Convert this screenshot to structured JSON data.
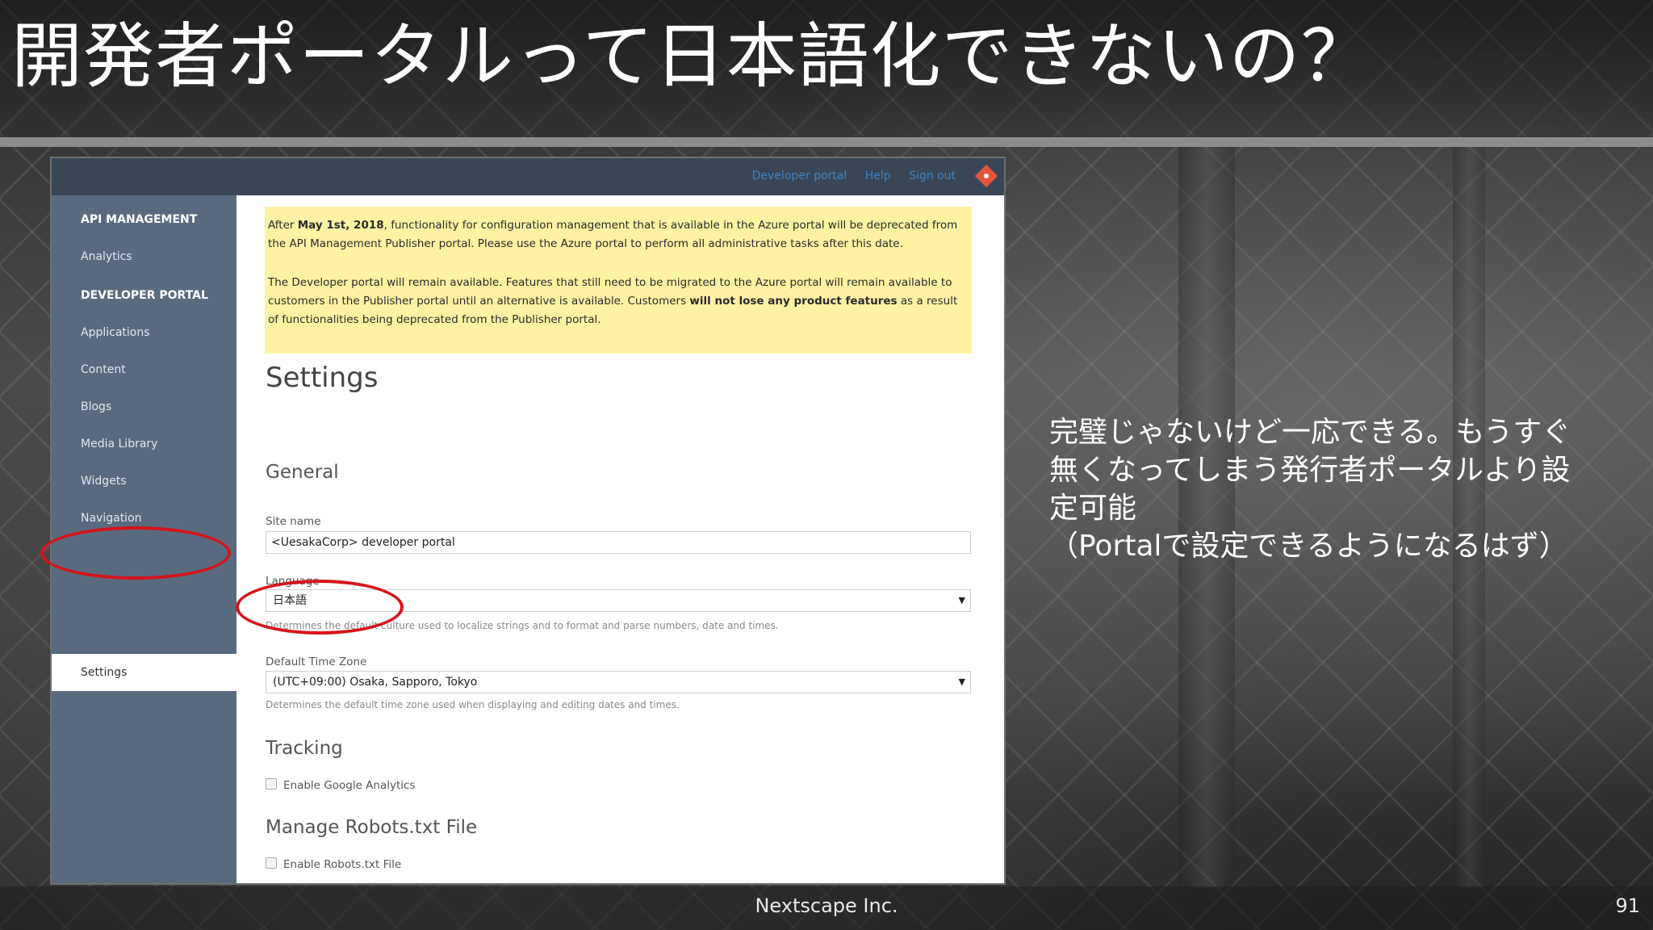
{
  "slide": {
    "title": "開発者ポータルって日本語化できないの？",
    "note_lines": [
      "完璧じゃないけど一応できる。もうすぐ",
      "無くなってしまう発行者ポータルより設",
      "定可能",
      "（Portalで設定できるようになるはず）"
    ],
    "footer_company": "Nextscape Inc.",
    "page_number": "91"
  },
  "portal": {
    "top_links": [
      "Developer portal",
      "Help",
      "Sign out"
    ],
    "sidebar": {
      "section_api": "API MANAGEMENT",
      "analytics": "Analytics",
      "section_dev": "DEVELOPER PORTAL",
      "applications": "Applications",
      "content": "Content",
      "blogs": "Blogs",
      "media_library": "Media Library",
      "widgets": "Widgets",
      "navigation": "Navigation",
      "settings": "Settings"
    },
    "warning": {
      "p1_pre": "After ",
      "p1_bold": "May 1st, 2018",
      "p1_post": ", functionality for configuration management that is available in the Azure portal will be deprecated from the API Management Publisher portal. Please use the Azure portal to perform all administrative tasks after this date.",
      "p2_pre": "The Developer portal will remain available. Features that still need to be migrated to the Azure portal will remain available to customers in the Publisher portal until an alternative is available. Customers ",
      "p2_bold": "will not lose any product features",
      "p2_post": " as a result of functionalities being deprecated from the Publisher portal."
    },
    "page_heading": "Settings",
    "general_heading": "General",
    "site_name_label": "Site name",
    "site_name_value": "<UesakaCorp> developer portal",
    "language_label": "Language",
    "language_value": "日本語",
    "language_help": "Determines the default culture used to localize strings and to format and parse numbers, date and times.",
    "timezone_label": "Default Time Zone",
    "timezone_value": "(UTC+09:00) Osaka, Sapporo, Tokyo",
    "timezone_help": "Determines the default time zone used when displaying and editing dates and times.",
    "tracking_heading": "Tracking",
    "google_analytics_label": "Enable Google Analytics",
    "robots_heading": "Manage Robots.txt File",
    "robots_label": "Enable Robots.txt File"
  },
  "colors": {
    "sidebar": "#5a6a7e",
    "topbar": "#3a4655",
    "warning_bg": "#fdf2a3",
    "highlight_ellipse": "#d4141c"
  }
}
